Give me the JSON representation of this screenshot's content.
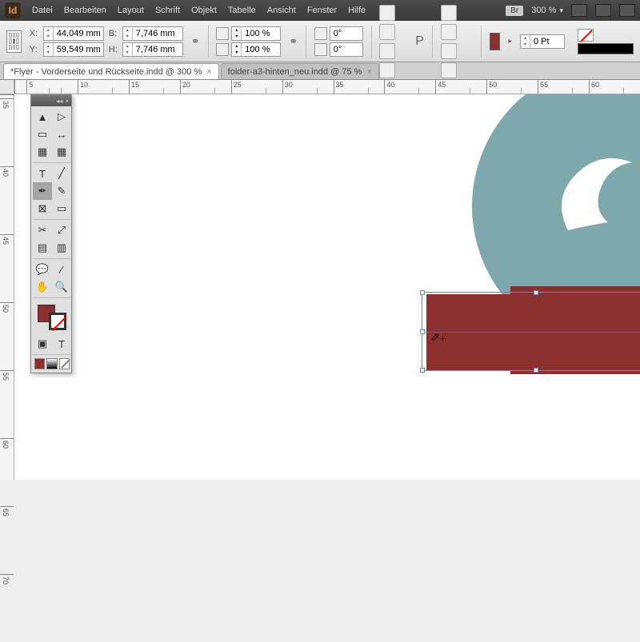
{
  "app": {
    "logo": "Id"
  },
  "menu": [
    "Datei",
    "Bearbeiten",
    "Layout",
    "Schrift",
    "Objekt",
    "Tabelle",
    "Ansicht",
    "Fenster",
    "Hilfe"
  ],
  "menubar_right": {
    "bridge": "Br",
    "zoom": "300 %"
  },
  "control": {
    "x": "44,049 mm",
    "y": "59,549 mm",
    "w": "7,746 mm",
    "h": "7,746 mm",
    "scale_x": "100 %",
    "scale_y": "100 %",
    "rotate": "0°",
    "shear": "0°",
    "stroke_weight": "0 Pt"
  },
  "tabs": [
    {
      "label": "*Flyer - Vorderseite und Rückseite.indd @ 300 %",
      "active": true
    },
    {
      "label": "folder-a3-hinten_neu.indd @ 75 %",
      "active": false
    }
  ],
  "ruler_h": [
    "5",
    "10",
    "15",
    "20",
    "25",
    "30",
    "35",
    "40",
    "45",
    "50",
    "55",
    "60"
  ],
  "ruler_v": [
    "35",
    "40",
    "45",
    "50",
    "55",
    "60",
    "65",
    "70"
  ],
  "colors": {
    "accent": "#8b2f2f",
    "teal": "#7fa8ad",
    "cream": "#f5eedc",
    "select": "#4a90d9"
  }
}
